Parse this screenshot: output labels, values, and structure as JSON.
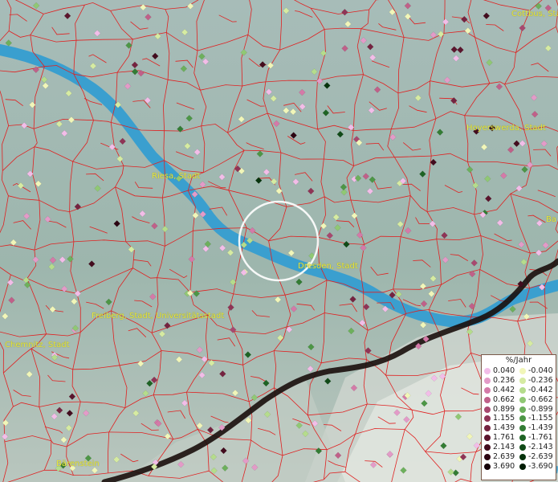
{
  "legend": {
    "title": "%/Jahr",
    "positive": [
      {
        "value": "0.040",
        "color": "#f2bde8"
      },
      {
        "value": "0.236",
        "color": "#e39bc8"
      },
      {
        "value": "0.442",
        "color": "#d47aa8"
      },
      {
        "value": "0.662",
        "color": "#c06089"
      },
      {
        "value": "0.899",
        "color": "#a8486f"
      },
      {
        "value": "1.155",
        "color": "#8f3456"
      },
      {
        "value": "1.439",
        "color": "#752340"
      },
      {
        "value": "1.761",
        "color": "#5b152d"
      },
      {
        "value": "2.143",
        "color": "#430c1e"
      },
      {
        "value": "2.639",
        "color": "#2c0512"
      },
      {
        "value": "3.690",
        "color": "#150108"
      }
    ],
    "negative": [
      {
        "value": "-0.040",
        "color": "#f1f6b9"
      },
      {
        "value": "-0.236",
        "color": "#d6eba2"
      },
      {
        "value": "-0.442",
        "color": "#b5dc8c"
      },
      {
        "value": "-0.662",
        "color": "#90c874"
      },
      {
        "value": "-0.899",
        "color": "#6db05c"
      },
      {
        "value": "-1.155",
        "color": "#4d9646"
      },
      {
        "value": "-1.439",
        "color": "#337c34"
      },
      {
        "value": "-1.761",
        "color": "#1e6324"
      },
      {
        "value": "-2.143",
        "color": "#104a17"
      },
      {
        "value": "-2.639",
        "color": "#06330c"
      },
      {
        "value": "-3.690",
        "color": "#011c04"
      }
    ]
  },
  "cities": [
    {
      "name": "Cottbus, Stadt"
    },
    {
      "name": "Hoyerswerda, Stadt"
    },
    {
      "name": "Riesa, Stadt"
    },
    {
      "name": "Dresden, Stadt"
    },
    {
      "name": "Freiberg, Stadt, Universitätsstadt"
    },
    {
      "name": "Chemnitz, Stadt"
    },
    {
      "name": "Bärenstein"
    },
    {
      "name": "Ba"
    }
  ],
  "colors": {
    "river": "#3a9fcf",
    "border": "#e02020",
    "boundary": "#1a0e0c",
    "label": "#e8e640"
  }
}
